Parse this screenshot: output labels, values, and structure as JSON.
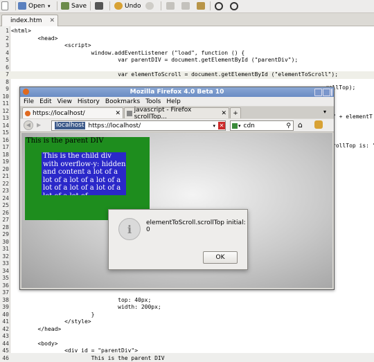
{
  "toolbar": {
    "open": "Open",
    "save": "Save",
    "undo": "Undo"
  },
  "editor_tab": {
    "name": "index.htm"
  },
  "code": [
    {
      "n": "1",
      "t": "<html>"
    },
    {
      "n": "2",
      "t": "        <head>"
    },
    {
      "n": "3",
      "t": "                <script>"
    },
    {
      "n": "4",
      "t": "                        window.addEventListener (\"load\", function () {"
    },
    {
      "n": "5",
      "t": "                                var parentDIV = document.getElementById (\"parentDiv\");"
    },
    {
      "n": "6",
      "t": ""
    },
    {
      "n": "7",
      "t": "                                var elementToScroll = document.getElementById (\"elementToScroll\");"
    },
    {
      "n": "8",
      "t": ""
    },
    {
      "n": "9",
      "t": ""
    },
    {
      "n": "10",
      "t": ""
    },
    {
      "n": "11",
      "t": ""
    },
    {
      "n": "12",
      "t": ""
    },
    {
      "n": "13",
      "t": ""
    },
    {
      "n": "14",
      "t": ""
    },
    {
      "n": "15",
      "t": ""
    },
    {
      "n": "16",
      "t": ""
    },
    {
      "n": "17",
      "t": ""
    },
    {
      "n": "18",
      "t": ""
    },
    {
      "n": "19",
      "t": ""
    },
    {
      "n": "20",
      "t": ""
    },
    {
      "n": "21",
      "t": ""
    },
    {
      "n": "22",
      "t": ""
    },
    {
      "n": "23",
      "t": ""
    },
    {
      "n": "24",
      "t": ""
    },
    {
      "n": "25",
      "t": ""
    },
    {
      "n": "26",
      "t": ""
    },
    {
      "n": "27",
      "t": ""
    },
    {
      "n": "28",
      "t": ""
    },
    {
      "n": "29",
      "t": ""
    },
    {
      "n": "30",
      "t": ""
    },
    {
      "n": "31",
      "t": ""
    },
    {
      "n": "32",
      "t": ""
    },
    {
      "n": "33",
      "t": ""
    },
    {
      "n": "34",
      "t": ""
    },
    {
      "n": "35",
      "t": ""
    },
    {
      "n": "36",
      "t": ""
    },
    {
      "n": "37",
      "t": ""
    },
    {
      "n": "38",
      "t": "                                top: 40px;"
    },
    {
      "n": "39",
      "t": "                                width: 200px;"
    },
    {
      "n": "40",
      "t": "                        }"
    },
    {
      "n": "41",
      "t": "                </style>"
    },
    {
      "n": "42",
      "t": "        </head>"
    },
    {
      "n": "43",
      "t": ""
    },
    {
      "n": "44",
      "t": "        <body>"
    },
    {
      "n": "45",
      "t": "                <div id = \"parentDiv\">"
    },
    {
      "n": "46",
      "t": "                        This is the parent DIV"
    }
  ],
  "code_right_fragments": {
    "line9": "rollTop);",
    "line12": "\" + elementT",
    "line15": "rollTop is: \""
  },
  "firefox": {
    "title": "Mozilla Firefox 4.0 Beta 10",
    "menu": [
      "File",
      "Edit",
      "View",
      "History",
      "Bookmarks",
      "Tools",
      "Help"
    ],
    "tab1": "https://localhost/",
    "tab2": "javascript - Firefox scrollTop...",
    "identity": "localhost",
    "url": "https://localhost/",
    "search": "cdn",
    "parent_text": "This is the parent DIV",
    "child_text": "This is the child div with overflow-y: hidden and content a lot of a lot of a lot of a lot of a lot of a lot of a lot of a lot of a lot of",
    "dialog_message": "elementToScroll.scrollTop initial: 0",
    "ok": "OK"
  }
}
